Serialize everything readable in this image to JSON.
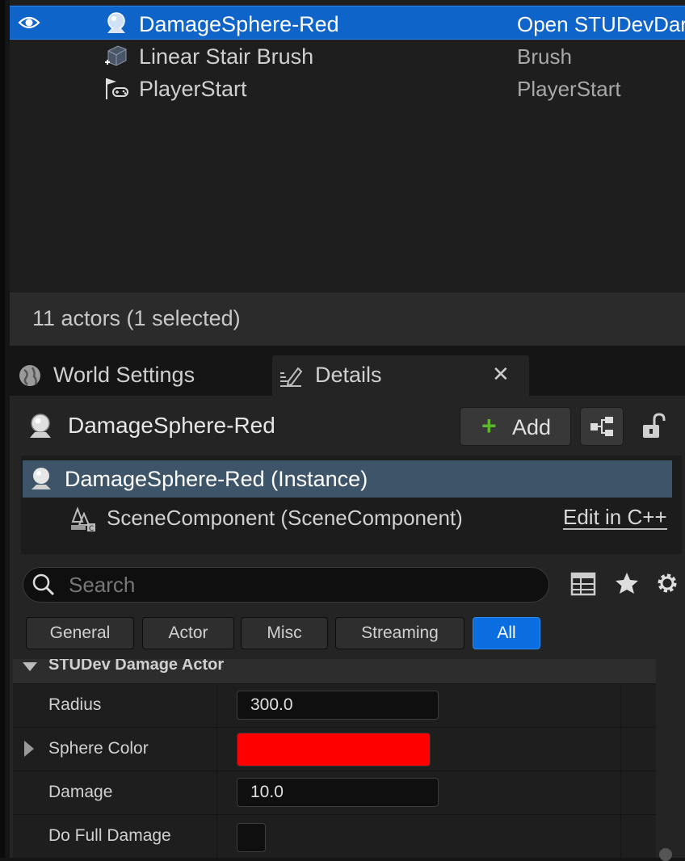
{
  "outliner": {
    "rows": [
      {
        "label": "DamageSphere-Red",
        "type": "Open STUDevDar",
        "selected": true,
        "icon": "damage-sphere-icon"
      },
      {
        "label": "Linear Stair Brush",
        "type": "Brush",
        "selected": false,
        "icon": "brush-cube-icon"
      },
      {
        "label": "PlayerStart",
        "type": "PlayerStart",
        "selected": false,
        "icon": "player-start-icon"
      }
    ],
    "status": "11 actors (1 selected)"
  },
  "tabs": {
    "world_settings": "World Settings",
    "details": "Details",
    "close": "✕"
  },
  "details": {
    "actor_name": "DamageSphere-Red",
    "add_label": "Add",
    "components": {
      "root": "DamageSphere-Red (Instance)",
      "child": "SceneComponent (SceneComponent)",
      "edit_cpp": "Edit in C++"
    },
    "search": {
      "placeholder": "Search"
    },
    "filters": [
      "General",
      "Actor",
      "Misc",
      "Streaming",
      "All"
    ],
    "active_filter": "All",
    "category": "STUDev Damage Actor",
    "properties": {
      "radius_label": "Radius",
      "radius_value": "300.0",
      "sphere_color_label": "Sphere Color",
      "sphere_color": "#ff0000",
      "damage_label": "Damage",
      "damage_value": "10.0",
      "full_damage_label": "Do Full Damage",
      "full_damage_checked": false
    }
  },
  "colors": {
    "selection": "#0e64c8",
    "accent_blue": "#0a6ee0",
    "add_green": "#5cb82a"
  }
}
